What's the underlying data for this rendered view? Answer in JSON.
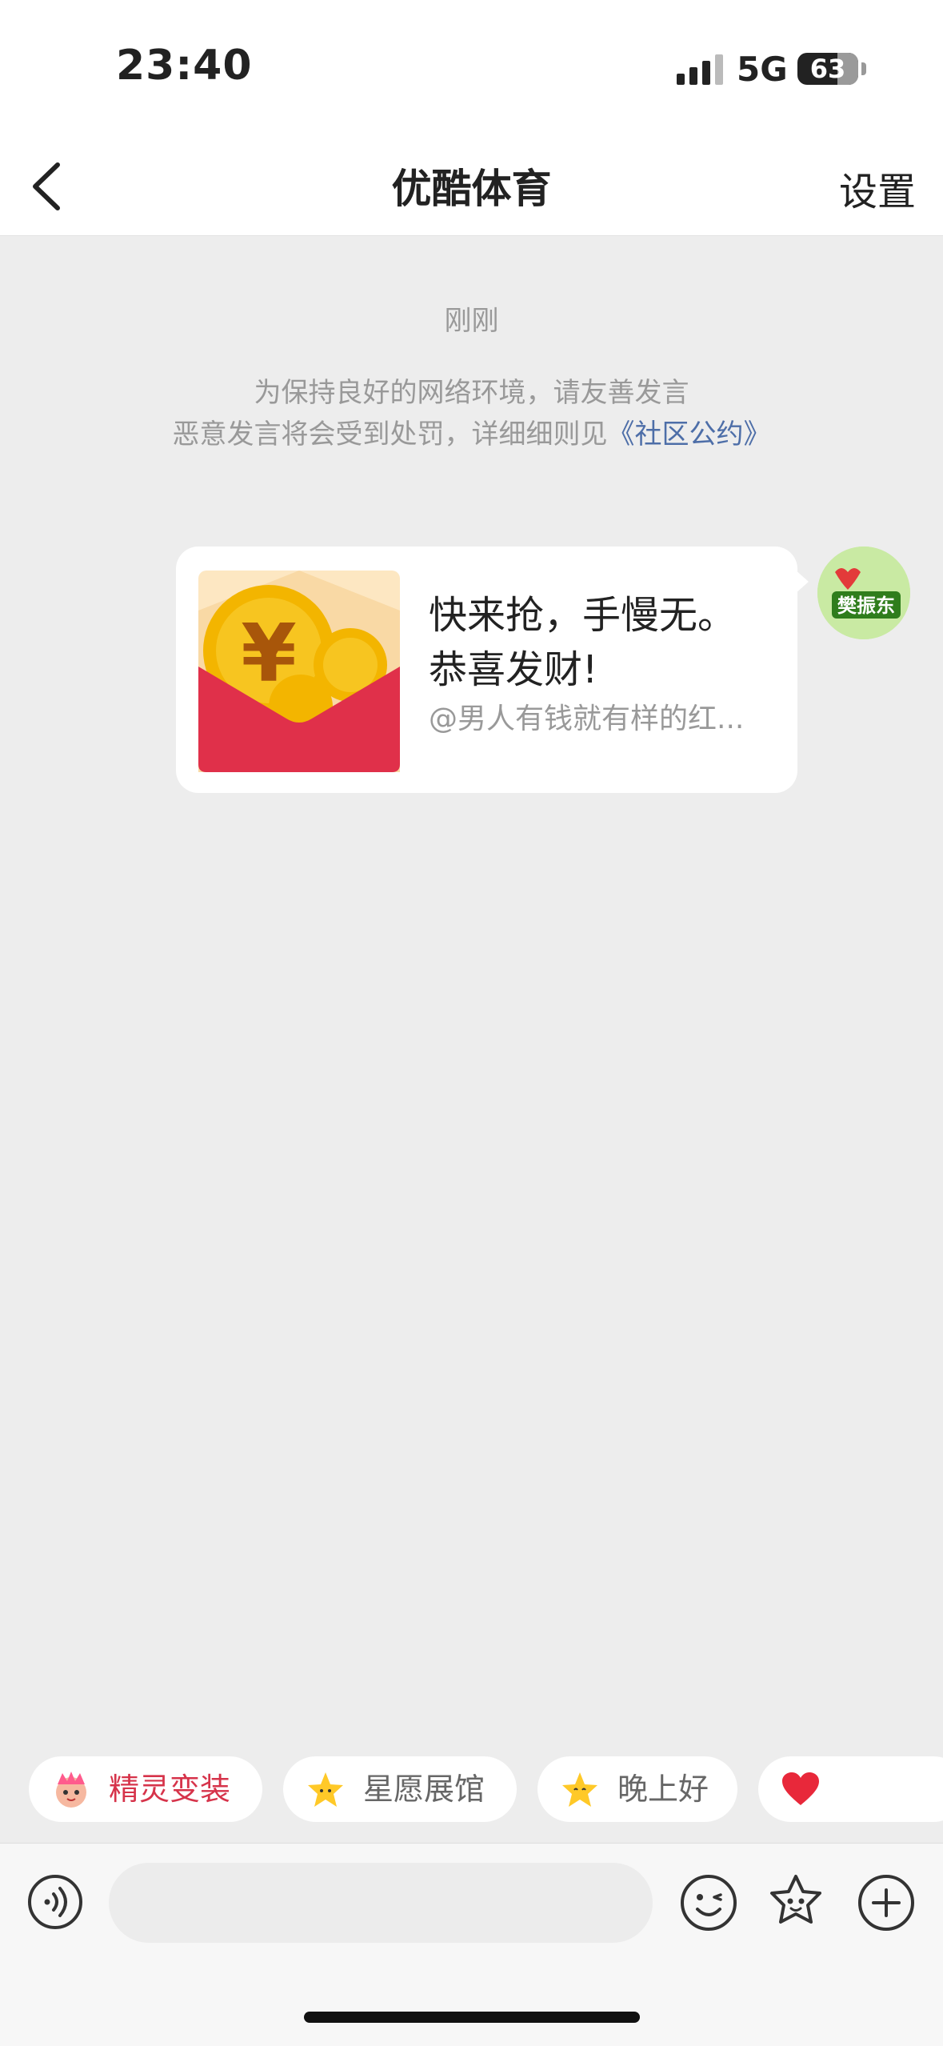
{
  "status_bar": {
    "time": "23:40",
    "network": "5G",
    "battery": "63"
  },
  "nav": {
    "title": "优酷体育",
    "settings_label": "设置"
  },
  "chat": {
    "timestamp": "刚刚",
    "notice_line1": "为保持良好的网络环境，请友善发言",
    "notice_line2": "恶意发言将会受到处罚，详细细则见",
    "notice_link": "《社区公约》"
  },
  "message": {
    "title_line1": "快来抢，手慢无。",
    "title_line2": "恭喜发财!",
    "subtitle": "@男人有钱就有样的红...",
    "avatar_text": "樊振东"
  },
  "quick_replies": [
    {
      "label": "精灵变装",
      "icon": "elf-icon"
    },
    {
      "label": "星愿展馆",
      "icon": "star-icon"
    },
    {
      "label": "晚上好",
      "icon": "star-face-icon"
    },
    {
      "label": "",
      "icon": "heart-icon"
    }
  ],
  "input": {
    "placeholder": ""
  },
  "colors": {
    "accent_red": "#d6334a",
    "link_blue": "#4d6ea8",
    "envelope_red": "#e0304a",
    "coin_gold": "#f3b500"
  }
}
